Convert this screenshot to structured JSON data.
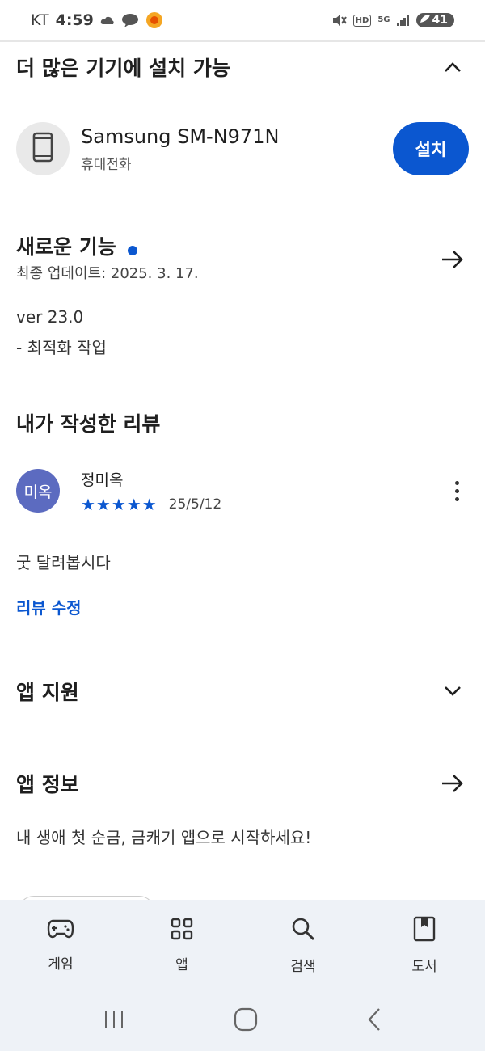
{
  "status_bar": {
    "carrier": "KT",
    "time": "4:59",
    "network": "5G",
    "battery": "41"
  },
  "install_section": {
    "title": "더 많은 기기에 설치 가능",
    "device_name": "Samsung SM-N971N",
    "device_type": "휴대전화",
    "install_label": "설치"
  },
  "whats_new": {
    "title": "새로운 기능",
    "updated": "최종 업데이트: 2025. 3. 17.",
    "lines": [
      "ver 23.0",
      "- 최적화 작업"
    ]
  },
  "my_review": {
    "title": "내가 작성한 리뷰",
    "avatar_text": "미옥",
    "reviewer": "정미옥",
    "rating": 5,
    "stars": "★★★★★",
    "date": "25/5/12",
    "text": "굿 달려봅시다",
    "edit_label": "리뷰 수정"
  },
  "app_support": {
    "title": "앱 지원"
  },
  "app_info": {
    "title": "앱 정보",
    "description": "내 생애 첫 순금, 금캐기 앱으로 시작하세요!"
  },
  "bottom_nav": {
    "items": [
      {
        "label": "게임",
        "icon": "gamepad-icon"
      },
      {
        "label": "앱",
        "icon": "apps-grid-icon"
      },
      {
        "label": "검색",
        "icon": "search-icon"
      },
      {
        "label": "도서",
        "icon": "book-icon"
      }
    ]
  },
  "colors": {
    "accent": "#0b57d0",
    "avatar": "#5c6bc0",
    "nav_bg": "#eef2f7"
  }
}
